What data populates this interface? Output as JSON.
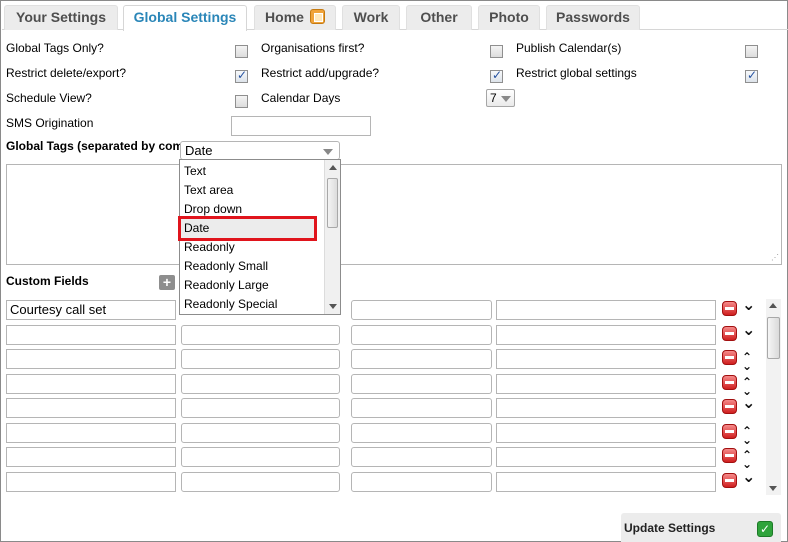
{
  "tabs": [
    {
      "label": "Your Settings",
      "active": false
    },
    {
      "label": "Global Settings",
      "active": true
    },
    {
      "label": "Home",
      "active": false,
      "icon": "edit-icon"
    },
    {
      "label": "Work",
      "active": false
    },
    {
      "label": "Other",
      "active": false
    },
    {
      "label": "Photo",
      "active": false
    },
    {
      "label": "Passwords",
      "active": false
    }
  ],
  "settings": {
    "global_tags_only": {
      "label": "Global Tags Only?",
      "checked": false
    },
    "organisations_first": {
      "label": "Organisations first?",
      "checked": false
    },
    "publish_calendar": {
      "label": "Publish Calendar(s)",
      "checked": false
    },
    "restrict_delete_export": {
      "label": "Restrict delete/export?",
      "checked": true
    },
    "restrict_add_upgrade": {
      "label": "Restrict add/upgrade?",
      "checked": true
    },
    "restrict_global_settings": {
      "label": "Restrict global settings",
      "checked": true
    },
    "schedule_view": {
      "label": "Schedule View?",
      "checked": false
    },
    "calendar_days": {
      "label": "Calendar Days",
      "value": "7"
    },
    "sms_origination": {
      "label": "SMS Origination",
      "value": ""
    }
  },
  "global_tags": {
    "label": "Global Tags (separated by com",
    "value": ""
  },
  "field_type_select": {
    "selected": "Date",
    "options": [
      "Text",
      "Text area",
      "Drop down",
      "Date",
      "Readonly",
      "Readonly Small",
      "Readonly Large",
      "Readonly Special"
    ],
    "highlighted": "Date"
  },
  "custom_fields": {
    "label": "Custom Fields",
    "add_symbol": "+",
    "rows": [
      {
        "name": "Courtesy call set",
        "type": "",
        "extra": "",
        "value": ""
      },
      {
        "name": "",
        "type": "",
        "extra": "",
        "value": ""
      },
      {
        "name": "",
        "type": "",
        "extra": "",
        "value": ""
      },
      {
        "name": "",
        "type": "",
        "extra": "",
        "value": ""
      },
      {
        "name": "",
        "type": "",
        "extra": "",
        "value": ""
      },
      {
        "name": "",
        "type": "",
        "extra": "",
        "value": ""
      },
      {
        "name": "",
        "type": "",
        "extra": "",
        "value": ""
      },
      {
        "name": "",
        "type": "",
        "extra": "",
        "value": ""
      }
    ]
  },
  "update": {
    "label": "Update Settings",
    "icon": "checkmark-icon"
  },
  "colors": {
    "accent": "#2a86b8",
    "highlight_border": "#e0141c",
    "ok_green": "#2fa33b",
    "delete_red": "#d01f1f"
  }
}
